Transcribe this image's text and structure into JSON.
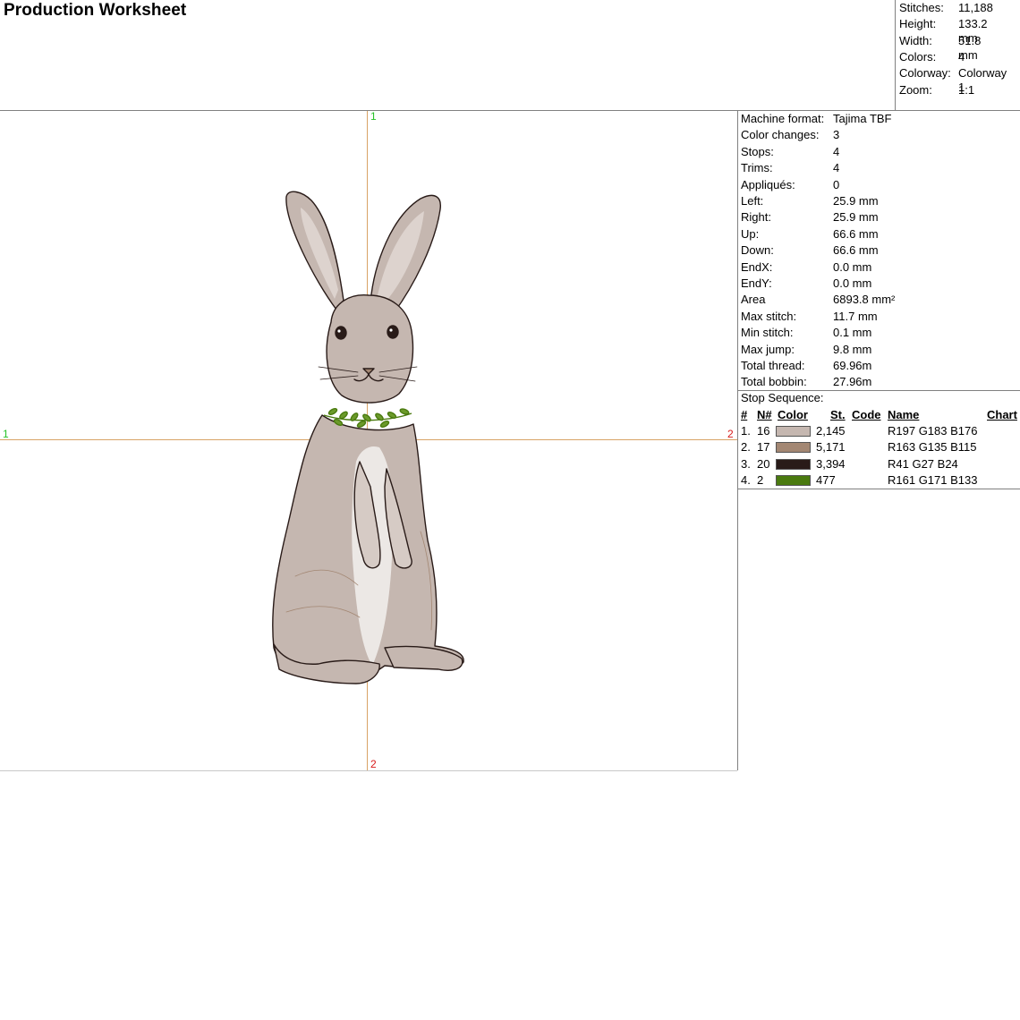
{
  "title": "Production Worksheet",
  "summary": [
    {
      "label": "Stitches:",
      "value": "11,188"
    },
    {
      "label": "Height:",
      "value": "133.2 mm"
    },
    {
      "label": "Width:",
      "value": "51.8 mm"
    },
    {
      "label": "Colors:",
      "value": "4"
    },
    {
      "label": "Colorway:",
      "value": "Colorway 1"
    },
    {
      "label": "Zoom:",
      "value": "1:1"
    }
  ],
  "axis_marks": {
    "top": "1",
    "bottom": "2",
    "left": "1",
    "right": "2"
  },
  "details": [
    {
      "label": "Machine format:",
      "value": "Tajima TBF"
    },
    {
      "label": "Color changes:",
      "value": "3"
    },
    {
      "label": "Stops:",
      "value": "4"
    },
    {
      "label": "Trims:",
      "value": "4"
    },
    {
      "label": "Appliqués:",
      "value": "0"
    },
    {
      "label": "Left:",
      "value": "25.9 mm"
    },
    {
      "label": "Right:",
      "value": "25.9 mm"
    },
    {
      "label": "Up:",
      "value": "66.6 mm"
    },
    {
      "label": "Down:",
      "value": "66.6 mm"
    },
    {
      "label": "EndX:",
      "value": "0.0 mm"
    },
    {
      "label": "EndY:",
      "value": "0.0 mm"
    },
    {
      "label": "Area",
      "value": "6893.8 mm²"
    },
    {
      "label": "Max stitch:",
      "value": "11.7 mm"
    },
    {
      "label": "Min stitch:",
      "value": "0.1 mm"
    },
    {
      "label": "Max jump:",
      "value": "9.8 mm"
    },
    {
      "label": "Total thread:",
      "value": "69.96m"
    },
    {
      "label": "Total bobbin:",
      "value": "27.96m"
    }
  ],
  "stop_sequence": {
    "title": "Stop Sequence:",
    "headers": {
      "index": "#",
      "needle": "N#",
      "color": "Color",
      "stitches": "St.",
      "code": "Code",
      "name": "Name",
      "chart": "Chart"
    },
    "rows": [
      {
        "index": "1.",
        "needle": "16",
        "color": "#c5b7b0",
        "stitches": "2,145",
        "code": "",
        "name": "R197 G183 B176",
        "chart": ""
      },
      {
        "index": "2.",
        "needle": "17",
        "color": "#a38773",
        "stitches": "5,171",
        "code": "",
        "name": "R163 G135 B115",
        "chart": ""
      },
      {
        "index": "3.",
        "needle": "20",
        "color": "#291b18",
        "stitches": "3,394",
        "code": "",
        "name": "R41 G27 B24",
        "chart": ""
      },
      {
        "index": "4.",
        "needle": "2",
        "color": "#4a7a0f",
        "stitches": "477",
        "code": "",
        "name": "R161 G171 B133",
        "chart": ""
      }
    ]
  },
  "colors": {
    "axis": "#d8a366",
    "mark_green": "#27c227",
    "mark_red": "#d81a1a",
    "outline": "#291b18",
    "fur_light": "#c5b7b0",
    "fur_mid": "#a38773",
    "leaf": "#4a7a0f"
  }
}
